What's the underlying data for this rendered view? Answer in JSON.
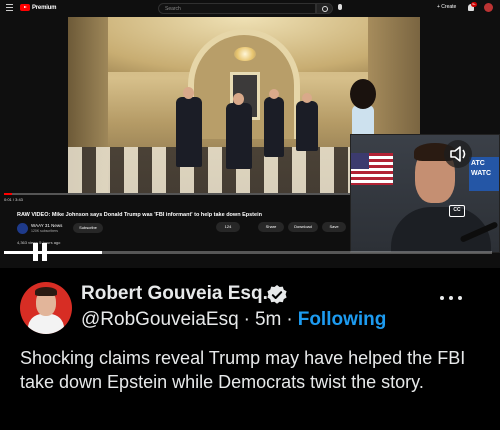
{
  "youtube": {
    "logo_text": "Premium",
    "search_placeholder": "Search",
    "create_label": "+ Create",
    "notif_count": "9+",
    "time": "0:01 / 3:43",
    "video_title": "RAW VIDEO: Mike Johnson says Donald Trump was 'FBI informant' to help take down Epstein",
    "channel_name": "WAAY 31 News",
    "channel_subs": "120K subscribers",
    "subscribe_label": "Subscribe",
    "likes": "124",
    "share_label": "Share",
    "download_label": "Download",
    "save_label": "Save",
    "views": "4,363 views  5 hours ago",
    "desc_snippet": "Video ... more",
    "cc_label": "CC",
    "sign_text": "ATC WATC"
  },
  "tweet": {
    "display_name": "Robert Gouveia Esq.",
    "handle": "@RobGouveiaEsq",
    "separator": "·",
    "time": "5m",
    "following_label": "Following",
    "text": "Shocking claims reveal Trump may have helped the FBI take down Epstein while Democrats twist the story."
  },
  "colors": {
    "accent_blue": "#1d9bf0",
    "background": "#000000",
    "text": "#e7e9ea",
    "youtube_red": "#ff0000"
  }
}
